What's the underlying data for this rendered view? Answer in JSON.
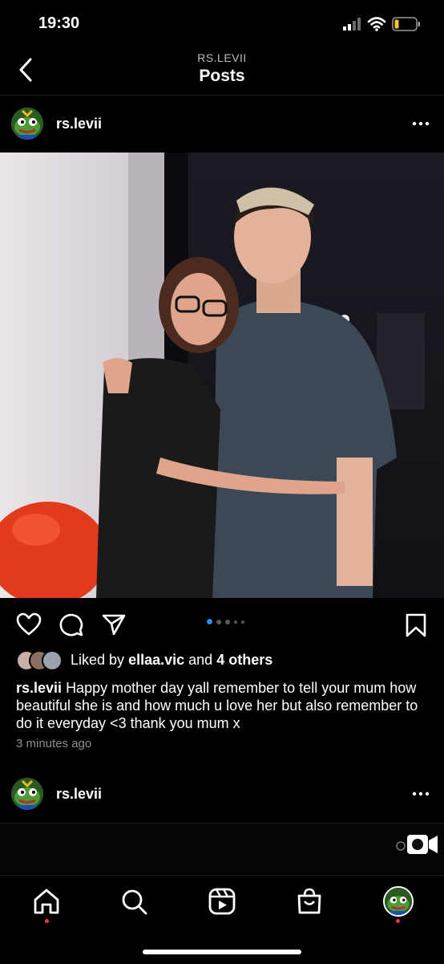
{
  "status_bar": {
    "time": "19:30"
  },
  "header": {
    "account": "RS.LEVII",
    "title": "Posts"
  },
  "post": {
    "username": "rs.levii",
    "carousel": {
      "count": 5,
      "active_index": 0
    },
    "liked_by_prefix": "Liked by",
    "liked_by_user": "ellaa.vic",
    "liked_by_joiner": "and",
    "liked_by_others": "4 others",
    "caption_username": "rs.levii",
    "caption_text": "Happy mother day yall remember to tell your mum how beautiful she is and how much u love her but also remember to do it everyday <3 thank you mum x",
    "time_ago": "3 minutes ago"
  },
  "next_post": {
    "username": "rs.levii"
  },
  "nav": {
    "items": [
      "home-icon",
      "search-icon",
      "reels-icon",
      "shop-icon",
      "profile-avatar"
    ]
  },
  "colors": {
    "accent": "#2e8cf0",
    "notification": "#ff3040",
    "background": "#000000"
  }
}
